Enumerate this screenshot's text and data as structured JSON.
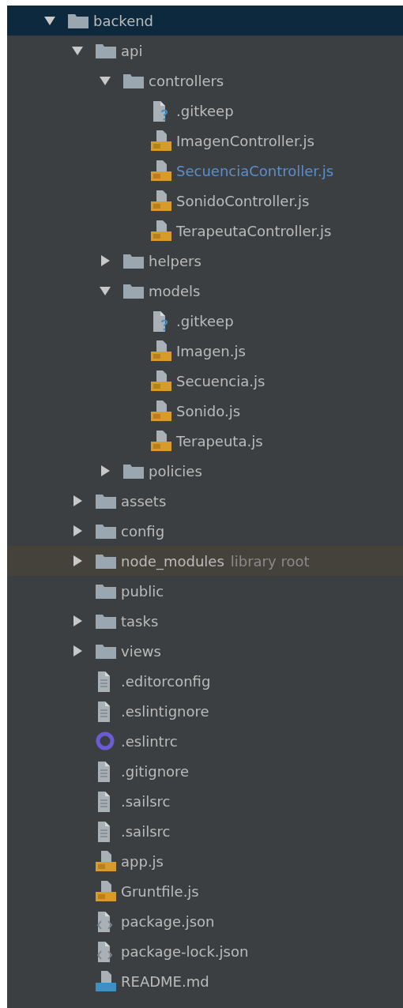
{
  "tree": [
    {
      "label": "backend",
      "kind": "folder",
      "expanded": true,
      "selected": true,
      "children": [
        {
          "label": "api",
          "kind": "folder",
          "expanded": true,
          "selected": false,
          "children": [
            {
              "label": "controllers",
              "kind": "folder",
              "expanded": true,
              "selected": false,
              "children": [
                {
                  "label": ".gitkeep",
                  "kind": "unknown",
                  "selected": false
                },
                {
                  "label": "ImagenController.js",
                  "kind": "js",
                  "selected": false
                },
                {
                  "label": "SecuenciaController.js",
                  "kind": "js",
                  "selected": false,
                  "color": "#5c8fc9"
                },
                {
                  "label": "SonidoController.js",
                  "kind": "js",
                  "selected": false
                },
                {
                  "label": "TerapeutaController.js",
                  "kind": "js",
                  "selected": false
                }
              ]
            },
            {
              "label": "helpers",
              "kind": "folder",
              "expanded": false,
              "selected": false
            },
            {
              "label": "models",
              "kind": "folder",
              "expanded": true,
              "selected": false,
              "children": [
                {
                  "label": ".gitkeep",
                  "kind": "unknown",
                  "selected": false
                },
                {
                  "label": "Imagen.js",
                  "kind": "js",
                  "selected": false
                },
                {
                  "label": "Secuencia.js",
                  "kind": "js",
                  "selected": false
                },
                {
                  "label": "Sonido.js",
                  "kind": "js",
                  "selected": false
                },
                {
                  "label": "Terapeuta.js",
                  "kind": "js",
                  "selected": false
                }
              ]
            },
            {
              "label": "policies",
              "kind": "folder",
              "expanded": false,
              "selected": false
            }
          ]
        },
        {
          "label": "assets",
          "kind": "folder",
          "expanded": false,
          "selected": false
        },
        {
          "label": "config",
          "kind": "folder",
          "expanded": false,
          "selected": false
        },
        {
          "label": "node_modules",
          "kind": "folder",
          "expanded": false,
          "selected": false,
          "note": "library root"
        },
        {
          "label": "public",
          "kind": "folder",
          "selected": false
        },
        {
          "label": "tasks",
          "kind": "folder",
          "expanded": false,
          "selected": false
        },
        {
          "label": "views",
          "kind": "folder",
          "expanded": false,
          "selected": false
        },
        {
          "label": ".editorconfig",
          "kind": "text",
          "selected": false
        },
        {
          "label": ".eslintignore",
          "kind": "text",
          "selected": false
        },
        {
          "label": ".eslintrc",
          "kind": "eslint",
          "selected": false
        },
        {
          "label": ".gitignore",
          "kind": "text",
          "selected": false
        },
        {
          "label": ".sailsrc",
          "kind": "text",
          "selected": false
        },
        {
          "label": ".sailsrc",
          "kind": "text",
          "selected": false
        },
        {
          "label": "app.js",
          "kind": "js",
          "selected": false
        },
        {
          "label": "Gruntfile.js",
          "kind": "js",
          "selected": false
        },
        {
          "label": "package.json",
          "kind": "json",
          "selected": false
        },
        {
          "label": "package-lock.json",
          "kind": "json",
          "selected": false
        },
        {
          "label": "README.md",
          "kind": "md",
          "selected": false
        }
      ]
    }
  ]
}
